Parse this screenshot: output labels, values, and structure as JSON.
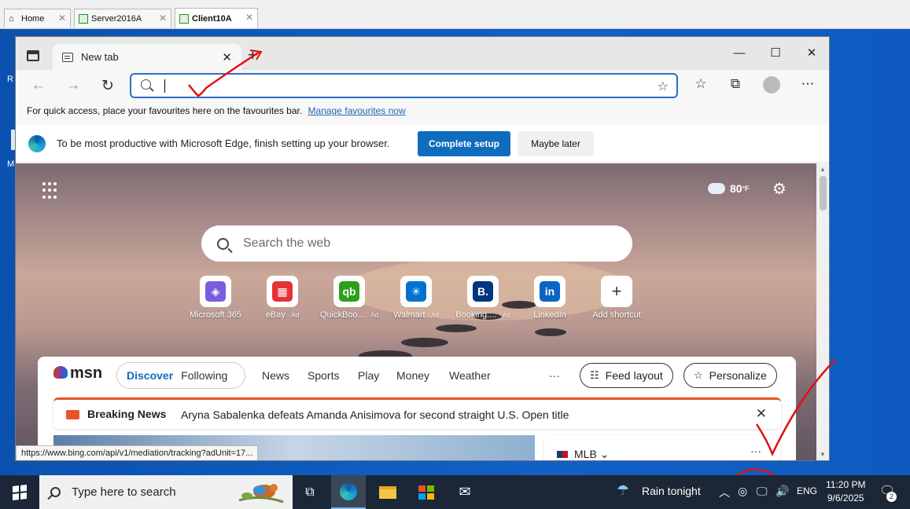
{
  "vm_tabs": [
    {
      "label": "Home"
    },
    {
      "label": "Server2016A"
    },
    {
      "label": "Client10A"
    }
  ],
  "desktop": {
    "icon_letter_1": "R",
    "icon_letter_2": "M"
  },
  "browser": {
    "tab": {
      "title": "New tab"
    },
    "window_controls": {
      "minimize": "—",
      "maximize": "☐",
      "close": "✕"
    },
    "nav": {
      "back": "←",
      "forward": "→",
      "refresh": "↻"
    },
    "address": {
      "value": "",
      "favorite_add": "☆"
    },
    "toolbar_icons": {
      "favorites": "☆",
      "collections": "⧉",
      "more": "⋯"
    },
    "favorites_bar": {
      "text": "For quick access, place your favourites here on the favourites bar.",
      "link": "Manage favourites now"
    },
    "setup_bar": {
      "text": "To be most productive with Microsoft Edge, finish setting up your browser.",
      "primary_button": "Complete setup",
      "secondary_button": "Maybe later"
    },
    "newtab": {
      "weather": {
        "temp": "80",
        "unit": "°F"
      },
      "search_placeholder": "Search the web",
      "tiles": [
        {
          "label": "Microsoft 365",
          "ad": "",
          "glyph": "◈",
          "color": "#7b5ce0"
        },
        {
          "label": "eBay",
          "ad": "· Ad",
          "glyph": "▦",
          "color": "#e53238"
        },
        {
          "label": "QuickBoo...",
          "ad": "· Ad",
          "glyph": "qb",
          "color": "#2ca01c"
        },
        {
          "label": "Walmart",
          "ad": "· Ad",
          "glyph": "✳",
          "color": "#0071ce"
        },
        {
          "label": "Booking....",
          "ad": "· Ad",
          "glyph": "B.",
          "color": "#003580"
        },
        {
          "label": "LinkedIn",
          "ad": "",
          "glyph": "in",
          "color": "#0a66c2"
        },
        {
          "label": "Add shortcut",
          "ad": "",
          "glyph": "+",
          "color": "#ffffff"
        }
      ],
      "msn": {
        "logo": "msn",
        "discover": "Discover",
        "following": "Following",
        "nav": [
          "News",
          "Sports",
          "Play",
          "Money",
          "Weather"
        ],
        "more": "···",
        "feed_layout": "Feed layout",
        "personalize": "Personalize",
        "breaking_label": "Breaking News",
        "breaking_text": "Aryna Sabalenka defeats Amanda Anisimova for second straight U.S. Open title",
        "card_title": "MLB",
        "card_more": "···"
      }
    },
    "status_url": "https://www.bing.com/api/v1/mediation/tracking?adUnit=17..."
  },
  "taskbar": {
    "search_placeholder": "Type here to search",
    "weather": "Rain tonight",
    "lang": "ENG",
    "time": "11:20 PM",
    "date": "9/6/2025",
    "notifications": "2"
  },
  "colors": {
    "accent": "#0f6cbd",
    "annotation": "#e01010",
    "taskbar": "#1b2736"
  }
}
